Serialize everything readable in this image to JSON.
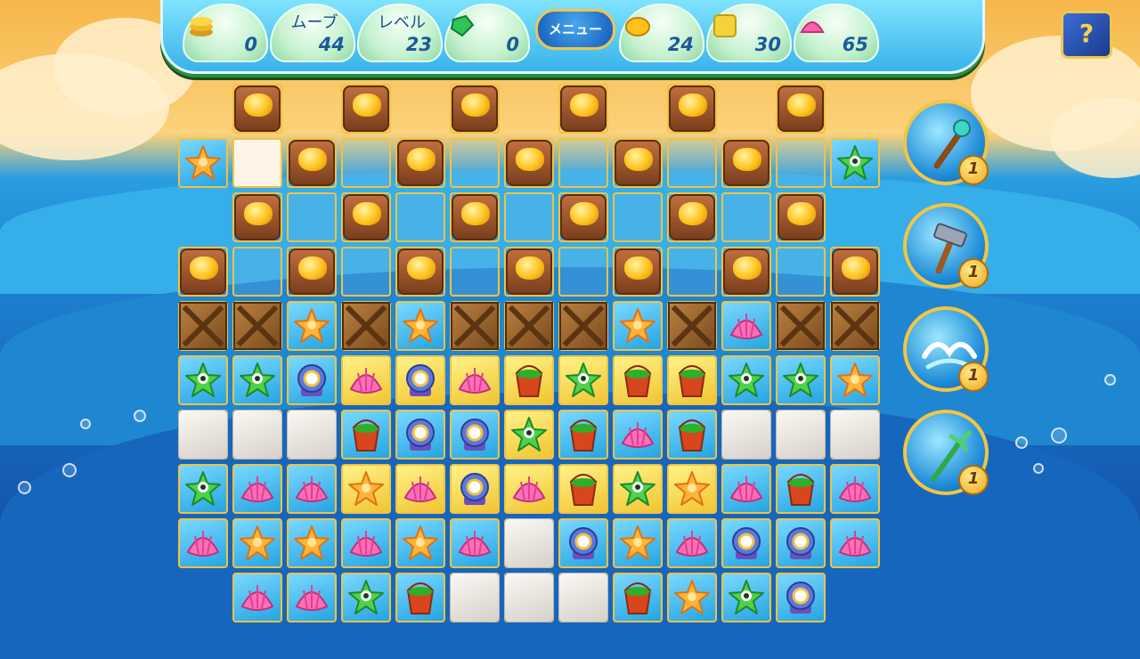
{
  "hud": {
    "coins": {
      "value": "0",
      "icon": "coin-stack-icon"
    },
    "moves": {
      "label": "ムーブ",
      "value": "44"
    },
    "level": {
      "label": "レベル",
      "value": "23"
    },
    "gems": {
      "value": "0",
      "icon": "green-gem-icon"
    },
    "menu_label": "メニュー",
    "gold_goal": {
      "value": "24",
      "icon": "gold-nugget-icon"
    },
    "tile_goal": {
      "value": "30",
      "icon": "yellow-tile-icon"
    },
    "shell_goal": {
      "value": "65",
      "icon": "pink-shell-icon"
    },
    "help_label": "?"
  },
  "tools": [
    {
      "name": "magic-staff",
      "count": "1",
      "icon": "staff-icon"
    },
    {
      "name": "hammer",
      "count": "1",
      "icon": "hammer-icon"
    },
    {
      "name": "wave",
      "count": "1",
      "icon": "wave-icon"
    },
    {
      "name": "trident",
      "count": "1",
      "icon": "trident-icon"
    }
  ],
  "board": {
    "legend": {
      "G": "gold-block",
      "C": "crate",
      "W": "stone-block",
      "E": "empty-cell",
      "S": "starfish",
      "F": "green-starfish",
      "P": "pink-shell",
      "D": "diving-helmet",
      "B": "bucket"
    },
    "cells": [
      [
        [
          1,
          "G"
        ],
        [
          3,
          "G"
        ],
        [
          5,
          "G"
        ],
        [
          7,
          "G"
        ],
        [
          9,
          "G"
        ],
        [
          11,
          "G"
        ]
      ],
      [
        [
          0,
          "S",
          "b"
        ],
        [
          1,
          "E",
          "w"
        ],
        [
          2,
          "G"
        ],
        [
          3,
          "E"
        ],
        [
          4,
          "G"
        ],
        [
          5,
          "E"
        ],
        [
          6,
          "G"
        ],
        [
          7,
          "E"
        ],
        [
          8,
          "G"
        ],
        [
          9,
          "E"
        ],
        [
          10,
          "G"
        ],
        [
          11,
          "E"
        ],
        [
          12,
          "F",
          "b"
        ]
      ],
      [
        [
          1,
          "G"
        ],
        [
          2,
          "E"
        ],
        [
          3,
          "G"
        ],
        [
          4,
          "E"
        ],
        [
          5,
          "G"
        ],
        [
          6,
          "E"
        ],
        [
          7,
          "G"
        ],
        [
          8,
          "E"
        ],
        [
          9,
          "G"
        ],
        [
          10,
          "E"
        ],
        [
          11,
          "G"
        ]
      ],
      [
        [
          0,
          "G"
        ],
        [
          1,
          "E"
        ],
        [
          2,
          "G"
        ],
        [
          3,
          "E"
        ],
        [
          4,
          "G"
        ],
        [
          5,
          "E"
        ],
        [
          6,
          "G"
        ],
        [
          7,
          "E"
        ],
        [
          8,
          "G"
        ],
        [
          9,
          "E"
        ],
        [
          10,
          "G"
        ],
        [
          11,
          "E"
        ],
        [
          12,
          "G"
        ]
      ],
      [
        [
          0,
          "C"
        ],
        [
          1,
          "C"
        ],
        [
          2,
          "S",
          "b"
        ],
        [
          3,
          "C"
        ],
        [
          4,
          "S",
          "b"
        ],
        [
          5,
          "C"
        ],
        [
          6,
          "C"
        ],
        [
          7,
          "C"
        ],
        [
          8,
          "S",
          "b"
        ],
        [
          9,
          "C"
        ],
        [
          10,
          "P",
          "b"
        ],
        [
          11,
          "C"
        ],
        [
          12,
          "C"
        ]
      ],
      [
        [
          0,
          "F",
          "b"
        ],
        [
          1,
          "F",
          "b"
        ],
        [
          2,
          "D",
          "b"
        ],
        [
          3,
          "P",
          "y"
        ],
        [
          4,
          "D",
          "y"
        ],
        [
          5,
          "P",
          "y"
        ],
        [
          6,
          "B",
          "y"
        ],
        [
          7,
          "F",
          "y"
        ],
        [
          8,
          "B",
          "y"
        ],
        [
          9,
          "B",
          "y"
        ],
        [
          10,
          "F",
          "b"
        ],
        [
          11,
          "F",
          "b"
        ],
        [
          12,
          "S",
          "b"
        ]
      ],
      [
        [
          0,
          "W"
        ],
        [
          1,
          "W"
        ],
        [
          2,
          "W"
        ],
        [
          3,
          "B",
          "b"
        ],
        [
          4,
          "D",
          "b"
        ],
        [
          5,
          "D",
          "b"
        ],
        [
          6,
          "F",
          "y"
        ],
        [
          7,
          "B",
          "b"
        ],
        [
          8,
          "P",
          "b"
        ],
        [
          9,
          "B",
          "b"
        ],
        [
          10,
          "W"
        ],
        [
          11,
          "W"
        ],
        [
          12,
          "W"
        ]
      ],
      [
        [
          0,
          "F",
          "b"
        ],
        [
          1,
          "P",
          "b"
        ],
        [
          2,
          "P",
          "b"
        ],
        [
          3,
          "S",
          "y"
        ],
        [
          4,
          "P",
          "y"
        ],
        [
          5,
          "D",
          "y"
        ],
        [
          6,
          "P",
          "y"
        ],
        [
          7,
          "B",
          "y"
        ],
        [
          8,
          "F",
          "y"
        ],
        [
          9,
          "S",
          "y"
        ],
        [
          10,
          "P",
          "b"
        ],
        [
          11,
          "B",
          "b"
        ],
        [
          12,
          "P",
          "b"
        ]
      ],
      [
        [
          0,
          "P",
          "b"
        ],
        [
          1,
          "S",
          "b"
        ],
        [
          2,
          "S",
          "b"
        ],
        [
          3,
          "P",
          "b"
        ],
        [
          4,
          "S",
          "b"
        ],
        [
          5,
          "P",
          "b"
        ],
        [
          6,
          "W"
        ],
        [
          7,
          "D",
          "b"
        ],
        [
          8,
          "S",
          "b"
        ],
        [
          9,
          "P",
          "b"
        ],
        [
          10,
          "D",
          "b"
        ],
        [
          11,
          "D",
          "b"
        ],
        [
          12,
          "P",
          "b"
        ]
      ],
      [
        [
          1,
          "P",
          "b"
        ],
        [
          2,
          "P",
          "b"
        ],
        [
          3,
          "F",
          "b"
        ],
        [
          4,
          "B",
          "b"
        ],
        [
          5,
          "W"
        ],
        [
          6,
          "W"
        ],
        [
          7,
          "W"
        ],
        [
          8,
          "B",
          "b"
        ],
        [
          9,
          "S",
          "b"
        ],
        [
          10,
          "F",
          "b"
        ],
        [
          11,
          "D",
          "b"
        ]
      ]
    ]
  }
}
